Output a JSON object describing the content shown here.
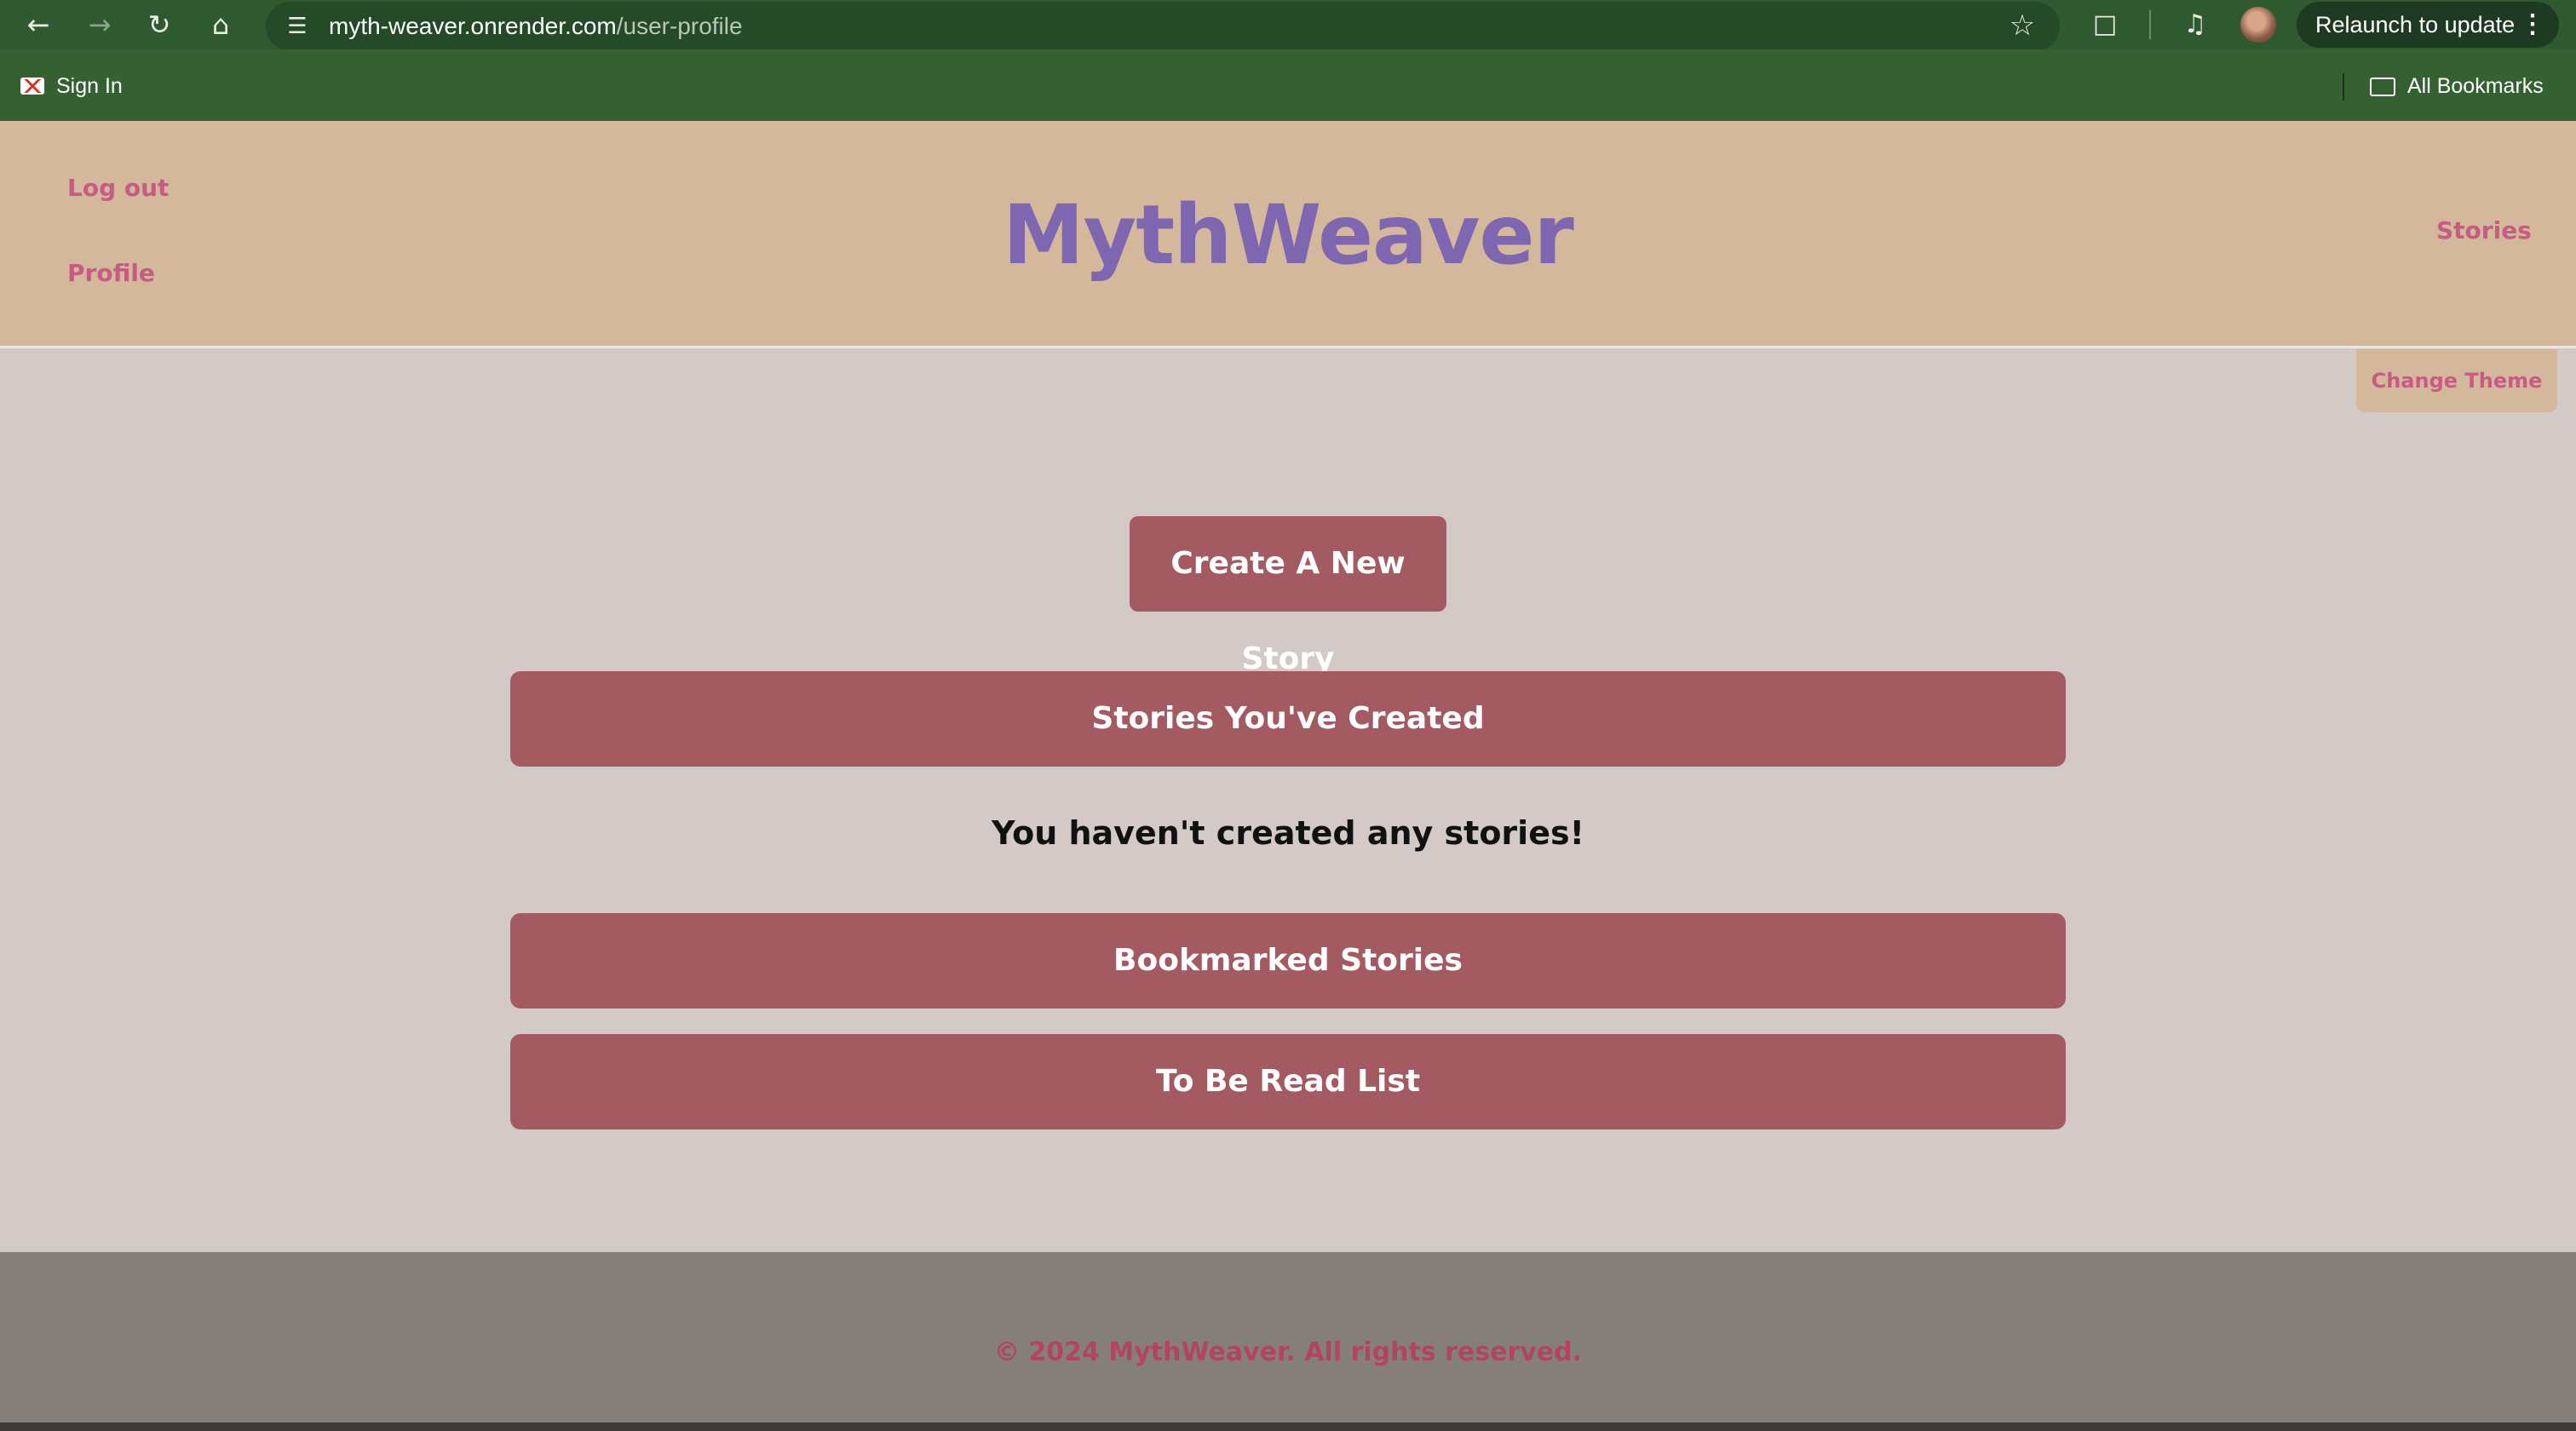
{
  "browser": {
    "back_icon": "arrow-left-icon",
    "forward_icon": "arrow-right-icon",
    "reload_icon": "reload-icon",
    "home_icon": "home-icon",
    "url_domain": "myth-weaver.onrender.com",
    "url_path": "/user-profile",
    "relaunch_label": "Relaunch to update",
    "bookmarks": {
      "signin_label": "Sign In",
      "all_bookmarks_label": "All Bookmarks"
    },
    "colors": {
      "toolbar": "#2f5a2f",
      "bookmarks_bar": "#356132"
    }
  },
  "header": {
    "logo": "MythWeaver",
    "logout_label": "Log out",
    "profile_label": "Profile",
    "stories_label": "Stories",
    "change_theme_label": "Change Theme",
    "colors": {
      "background": "#d4b89c",
      "link": "#c75b84",
      "logo": "#7e67b0"
    }
  },
  "main": {
    "create_button_label": "Create A New Story",
    "sections": {
      "created_label": "Stories You've Created",
      "empty_message": "You haven't created any stories!",
      "bookmarked_label": "Bookmarked Stories",
      "tbr_label": "To Be Read List"
    },
    "colors": {
      "background": "#d3c9c6",
      "button": "#a35a60"
    }
  },
  "footer": {
    "text": "© 2024 MythWeaver. All rights reserved.",
    "colors": {
      "background": "#857f7c",
      "text": "#b2445e"
    }
  }
}
